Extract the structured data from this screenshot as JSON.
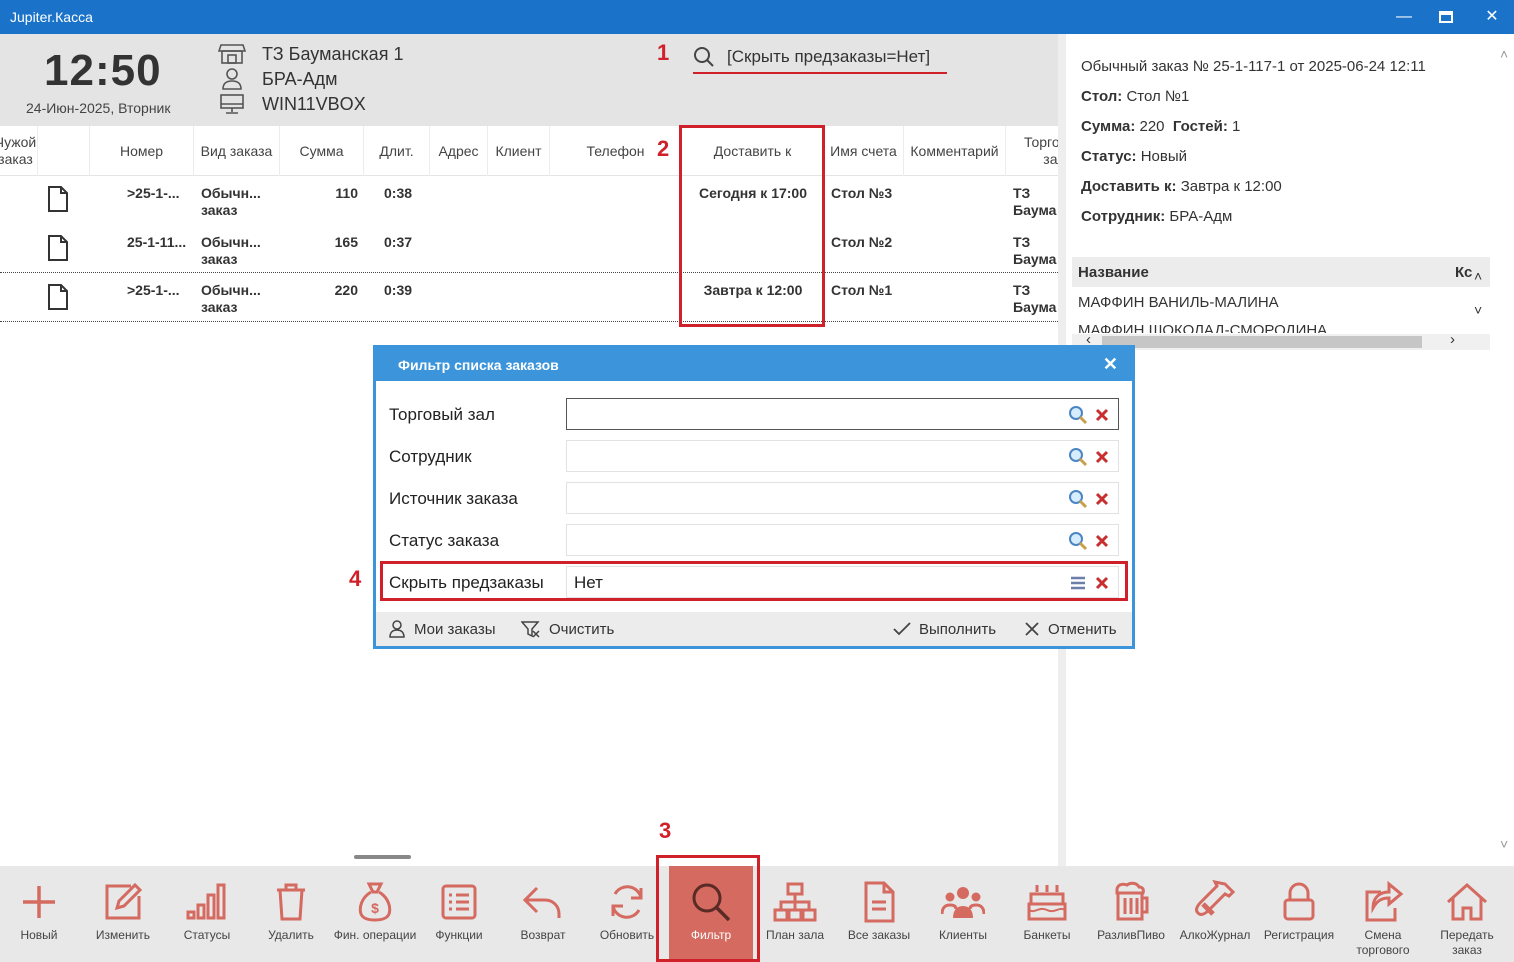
{
  "window": {
    "title": "Jupiter.Касса"
  },
  "header": {
    "time": "12:50",
    "date": "24-Июн-2025, Вторник",
    "shop": "ТЗ Бауманская 1",
    "user": "БРА-Адм",
    "computer": "WIN11VBOX",
    "filter_text": "[Скрыть предзаказы=Нет]"
  },
  "annotations": {
    "n1": "1",
    "n2": "2",
    "n3": "3",
    "n4": "4"
  },
  "table": {
    "columns": [
      "Чужой заказ",
      "Номер",
      "Вид заказа",
      "Сумма",
      "Длит.",
      "Адрес",
      "Клиент",
      "Телефон",
      "Доставить к",
      "Имя счета",
      "Комментарий",
      "Торговый зал"
    ],
    "rows": [
      {
        "number": ">25-1-...",
        "type": "Обычн... заказ",
        "sum": "110",
        "duration": "0:38",
        "deliver": "Сегодня к 17:00",
        "account": "Стол №3",
        "hall": "ТЗ Баума"
      },
      {
        "number": "25-1-11...",
        "type": "Обычн... заказ",
        "sum": "165",
        "duration": "0:37",
        "deliver": "",
        "account": "Стол №2",
        "hall": "ТЗ Баума"
      },
      {
        "number": ">25-1-...",
        "type": "Обычн... заказ",
        "sum": "220",
        "duration": "0:39",
        "deliver": "Завтра к 12:00",
        "account": "Стол №1",
        "hall": "ТЗ Баума"
      }
    ]
  },
  "details": {
    "title": "Обычный заказ № 25-1-117-1 от 2025-06-24 12:11",
    "table_label": "Стол:",
    "table_value": "Стол №1",
    "sum_label": "Сумма:",
    "sum_value": "220",
    "guests_label": "Гостей:",
    "guests_value": "1",
    "status_label": "Статус:",
    "status_value": "Новый",
    "deliver_label": "Доставить к:",
    "deliver_value": "Завтра к 12:00",
    "employee_label": "Сотрудник:",
    "employee_value": "БРА-Адм",
    "items_header_name": "Название",
    "items_header_qty": "Кс",
    "items": [
      "МАФФИН ВАНИЛЬ-МАЛИНА",
      "МАФФИН ШОКОЛАД-СМОРОДИНА"
    ]
  },
  "dialog": {
    "title": "Фильтр списка заказов",
    "fields": [
      {
        "label": "Торговый зал",
        "value": ""
      },
      {
        "label": "Сотрудник",
        "value": ""
      },
      {
        "label": "Источник заказа",
        "value": ""
      },
      {
        "label": "Статус заказа",
        "value": ""
      },
      {
        "label": "Скрыть предзаказы",
        "value": "Нет"
      }
    ],
    "my_orders": "Мои заказы",
    "clear": "Очистить",
    "run": "Выполнить",
    "cancel": "Отменить"
  },
  "toolbar": {
    "accent": "#d46a60",
    "buttons": [
      "Новый",
      "Изменить",
      "Статусы",
      "Удалить",
      "Фин. операции",
      "Функции",
      "Возврат",
      "Обновить",
      "Фильтр",
      "План зала",
      "Все заказы",
      "Клиенты",
      "Банкеты",
      "РазливПиво",
      "АлкоЖурнал",
      "Регистрация",
      "Смена торгового",
      "Передать заказ"
    ]
  }
}
